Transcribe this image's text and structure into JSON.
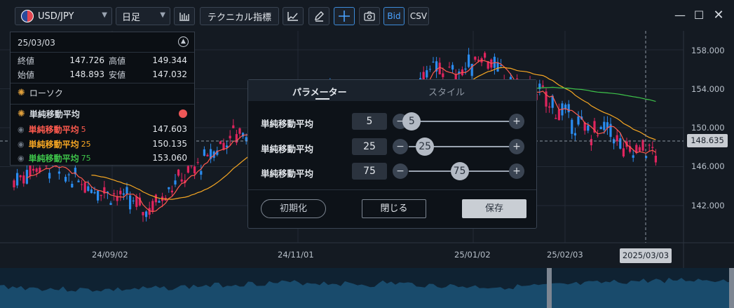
{
  "toolbar": {
    "symbol": "USD/JPY",
    "timeframe": "日足",
    "indicator_label": "テクニカル指標",
    "bid_label": "Bid",
    "csv_label": "CSV"
  },
  "legend": {
    "date": "25/03/03",
    "close_label": "終値",
    "close": "147.726",
    "high_label": "高値",
    "high": "149.344",
    "open_label": "始値",
    "open": "148.893",
    "low_label": "安値",
    "low": "147.032",
    "candle_label": "ローソク",
    "sma_group_label": "単純移動平均",
    "sma": [
      {
        "label": "単純移動平均",
        "period": "5",
        "value": "147.603",
        "color": "#ff5a4e"
      },
      {
        "label": "単純移動平均",
        "period": "25",
        "value": "150.135",
        "color": "#f5a623"
      },
      {
        "label": "単純移動平均",
        "period": "75",
        "value": "153.060",
        "color": "#3ec44a"
      }
    ]
  },
  "axes": {
    "y_ticks": [
      "158.000",
      "154.000",
      "150.000",
      "146.000",
      "142.000"
    ],
    "x_ticks": [
      "24/09/02",
      "24/11/01",
      "25/01/02",
      "25/02/03"
    ],
    "current_price": "148.635",
    "cursor_date": "2025/03/03"
  },
  "dialog": {
    "tab_params": "パラメーター",
    "tab_style": "スタイル",
    "rows": [
      {
        "label": "単純移動平均",
        "value": "5",
        "fraction": 0.03
      },
      {
        "label": "単純移動平均",
        "value": "25",
        "fraction": 0.16
      },
      {
        "label": "単純移動平均",
        "value": "75",
        "fraction": 0.5
      }
    ],
    "minus": "−",
    "plus": "+",
    "reset_label": "初期化",
    "close_label": "閉じる",
    "save_label": "保存"
  },
  "colors": {
    "up": "#2a8cf0",
    "down": "#e0245e",
    "sma5": "#ff5a4e",
    "sma25": "#f5a623",
    "sma75": "#3ec44a"
  }
}
